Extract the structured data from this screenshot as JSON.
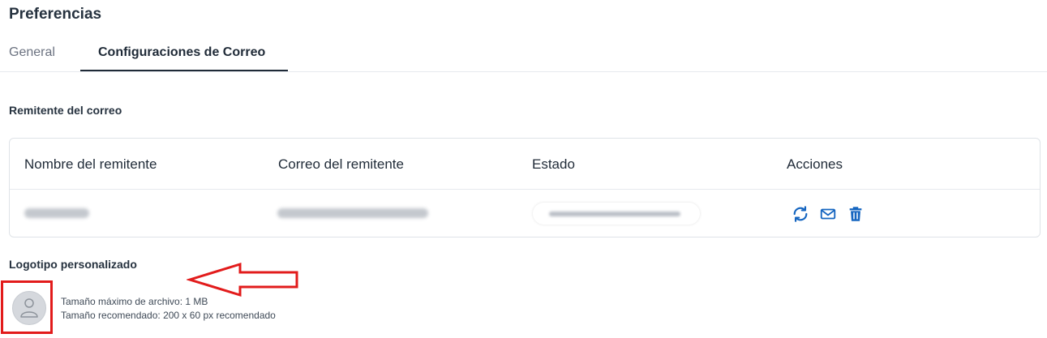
{
  "page": {
    "title": "Preferencias"
  },
  "tabs": [
    {
      "label": "General",
      "active": false
    },
    {
      "label": "Configuraciones de Correo",
      "active": true
    }
  ],
  "sender_section": {
    "title": "Remitente del correo",
    "columns": [
      "Nombre del remitente",
      "Correo del remitente",
      "Estado",
      "Acciones"
    ],
    "rows": [
      {
        "name": "",
        "email": "",
        "status": "",
        "actions": [
          "refresh-icon",
          "mail-icon",
          "trash-icon"
        ]
      }
    ]
  },
  "logo_section": {
    "title": "Logotipo personalizado",
    "max_size": "Tamaño máximo de archivo: 1 MB",
    "recommended_size": "Tamaño recomendado: 200 x 60 px recomendado"
  },
  "colors": {
    "accent": "#1565c0",
    "annotation": "#e21b1b"
  }
}
